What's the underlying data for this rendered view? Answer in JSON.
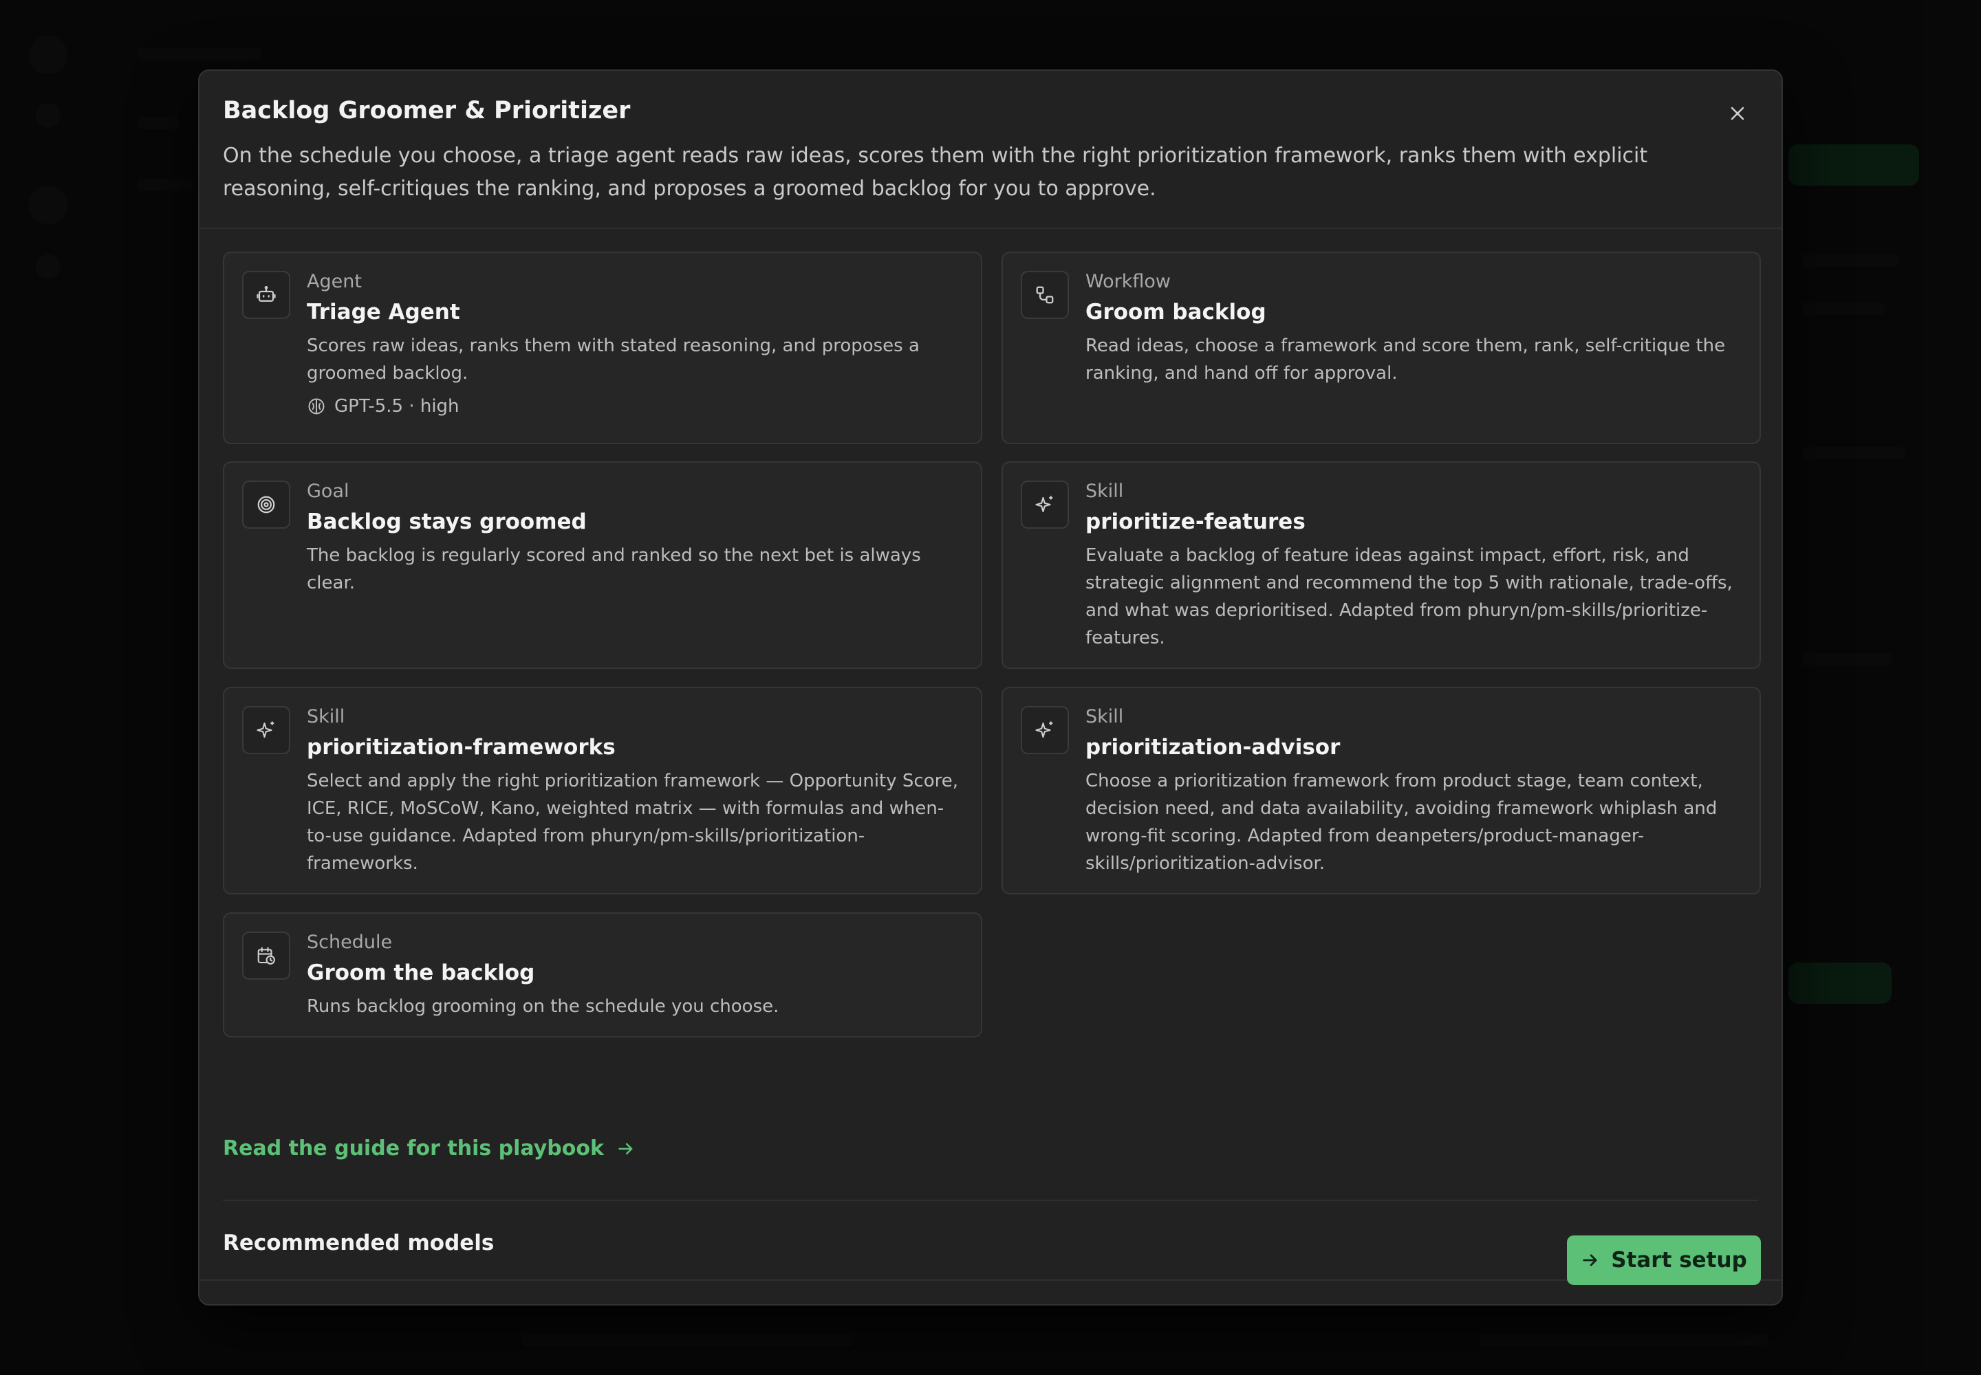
{
  "modal": {
    "title": "Backlog Groomer & Prioritizer",
    "description": "On the schedule you choose, a triage agent reads raw ideas, scores them with the right prioritization framework, ranks them with explicit reasoning, self-critiques the ranking, and proposes a groomed backlog for you to approve."
  },
  "cards": [
    {
      "kind": "Agent",
      "name": "Triage Agent",
      "body": "Scores raw ideas, ranks them with stated reasoning, and proposes a groomed backlog.",
      "meta": "GPT-5.5 · high",
      "icon": "robot-icon"
    },
    {
      "kind": "Workflow",
      "name": "Groom backlog",
      "body": "Read ideas, choose a framework and score them, rank, self-critique the ranking, and hand off for approval.",
      "icon": "workflow-icon"
    },
    {
      "kind": "Goal",
      "name": "Backlog stays groomed",
      "body": "The backlog is regularly scored and ranked so the next bet is always clear.",
      "icon": "target-icon"
    },
    {
      "kind": "Skill",
      "name": "prioritize-features",
      "body": "Evaluate a backlog of feature ideas against impact, effort, risk, and strategic alignment and recommend the top 5 with rationale, trade-offs, and what was deprioritised. Adapted from phuryn/pm-skills/prioritize-features.",
      "icon": "sparkle-icon"
    },
    {
      "kind": "Skill",
      "name": "prioritization-frameworks",
      "body": "Select and apply the right prioritization framework — Opportunity Score, ICE, RICE, MoSCoW, Kano, weighted matrix — with formulas and when-to-use guidance. Adapted from phuryn/pm-skills/prioritization-frameworks.",
      "icon": "sparkle-icon"
    },
    {
      "kind": "Skill",
      "name": "prioritization-advisor",
      "body": "Choose a prioritization framework from product stage, team context, decision need, and data availability, avoiding framework whiplash and wrong-fit scoring. Adapted from deanpeters/product-manager-skills/prioritization-advisor.",
      "icon": "sparkle-icon"
    },
    {
      "kind": "Schedule",
      "name": "Groom the backlog",
      "body": "Runs backlog grooming on the schedule you choose.",
      "icon": "calendar-clock-icon"
    }
  ],
  "guide_link": "Read the guide for this playbook",
  "recommended_models_title": "Recommended models",
  "start_button": "Start setup",
  "colors": {
    "accent": "#5cc177",
    "modal_bg": "#222222",
    "card_bg": "#262626"
  }
}
